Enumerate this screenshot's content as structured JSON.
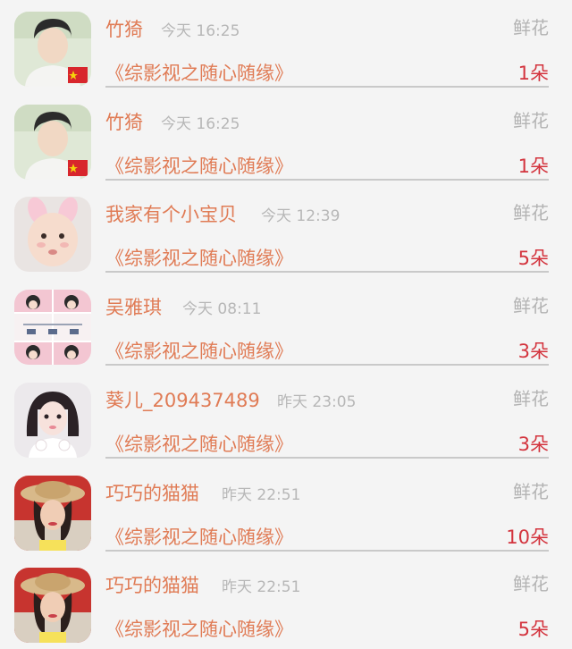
{
  "gift_rows": [
    {
      "user": "竹猗",
      "time": "今天 16:25",
      "gift_type": "鲜花",
      "novel_title": "《综影视之随心随缘》",
      "count": "1朵",
      "avatar_icon": "young-man-avatar-icon"
    },
    {
      "user": "竹猗",
      "time": "今天 16:25",
      "gift_type": "鲜花",
      "novel_title": "《综影视之随心随缘》",
      "count": "1朵",
      "avatar_icon": "young-man-avatar-icon"
    },
    {
      "user": "我家有个小宝贝",
      "time": "今天 12:39",
      "gift_type": "鲜花",
      "novel_title": "《综影视之随心随缘》",
      "count": "5朵",
      "avatar_icon": "baby-bunny-ears-avatar-icon"
    },
    {
      "user": "吴雅琪",
      "time": "今天 08:11",
      "gift_type": "鲜花",
      "novel_title": "《综影视之随心随缘》",
      "count": "3朵",
      "avatar_icon": "cartoon-girl-grid-avatar-icon"
    },
    {
      "user": "葵儿_209437489",
      "time": "昨天 23:05",
      "gift_type": "鲜花",
      "novel_title": "《综影视之随心随缘》",
      "count": "3朵",
      "avatar_icon": "girl-dark-hair-avatar-icon"
    },
    {
      "user": "巧巧的猫猫",
      "time": "昨天 22:51",
      "gift_type": "鲜花",
      "novel_title": "《综影视之随心随缘》",
      "count": "10朵",
      "avatar_icon": "woman-straw-hat-avatar-icon"
    },
    {
      "user": "巧巧的猫猫",
      "time": "昨天 22:51",
      "gift_type": "鲜花",
      "novel_title": "《综影视之随心随缘》",
      "count": "5朵",
      "avatar_icon": "woman-straw-hat-avatar-icon"
    }
  ],
  "colors": {
    "accent": "#e07b55",
    "count": "#d3333d",
    "muted": "#b7b7b7",
    "background": "#f4f4f4",
    "divider": "#c9c9c9"
  }
}
